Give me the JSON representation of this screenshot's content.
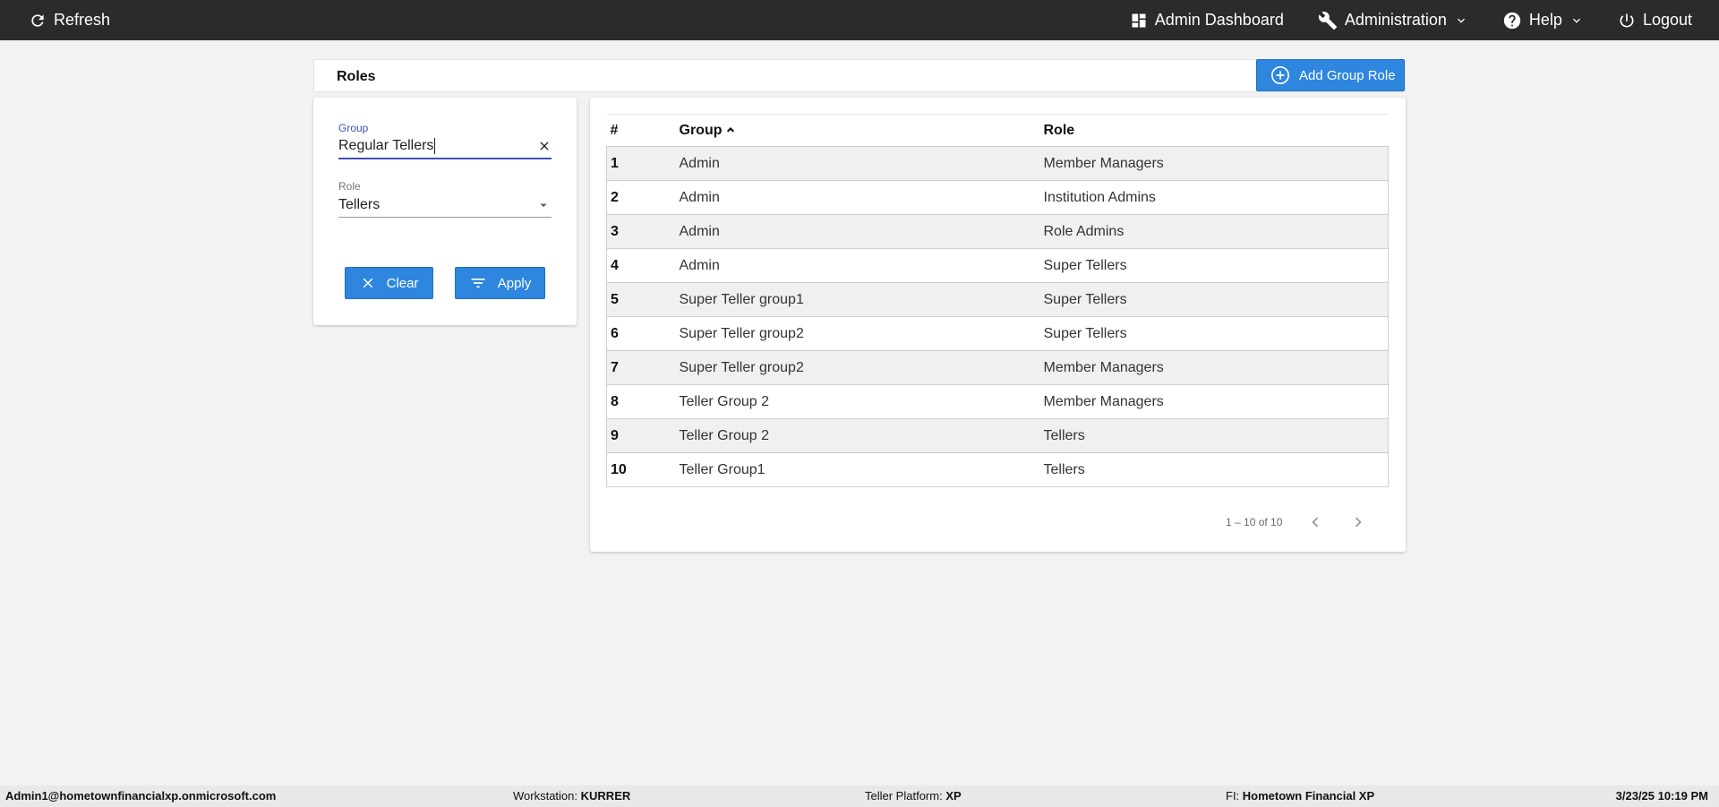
{
  "topbar": {
    "refresh_label": "Refresh",
    "admin_dashboard_label": "Admin Dashboard",
    "administration_label": "Administration",
    "help_label": "Help",
    "logout_label": "Logout"
  },
  "header": {
    "title": "Roles",
    "add_button_label": "Add Group Role"
  },
  "filter": {
    "group_label": "Group",
    "group_value": "Regular Tellers",
    "role_label": "Role",
    "role_value": "Tellers",
    "clear_label": "Clear",
    "apply_label": "Apply"
  },
  "table": {
    "columns": [
      "#",
      "Group",
      "Role"
    ],
    "rows": [
      [
        "1",
        "Admin",
        "Member Managers"
      ],
      [
        "2",
        "Admin",
        "Institution Admins"
      ],
      [
        "3",
        "Admin",
        "Role Admins"
      ],
      [
        "4",
        "Admin",
        "Super Tellers"
      ],
      [
        "5",
        "Super Teller group1",
        "Super Tellers"
      ],
      [
        "6",
        "Super Teller group2",
        "Super Tellers"
      ],
      [
        "7",
        "Super Teller group2",
        "Member Managers"
      ],
      [
        "8",
        "Teller Group 2",
        "Member Managers"
      ],
      [
        "9",
        "Teller Group 2",
        "Tellers"
      ],
      [
        "10",
        "Teller Group1",
        "Tellers"
      ]
    ],
    "pagination": "1 – 10 of 10"
  },
  "footer": {
    "user": "Admin1@hometownfinancialxp.onmicrosoft.com",
    "workstation_label": "Workstation:",
    "workstation_value": "KURRER",
    "platform_label": "Teller Platform:",
    "platform_value": "XP",
    "fi_label": "FI:",
    "fi_value": "Hometown Financial XP",
    "datetime": "3/23/25 10:19 PM"
  },
  "colors": {
    "topbar": "#2b2b2b",
    "primary_button": "#2e86de",
    "focus_accent": "#3f51b5"
  }
}
